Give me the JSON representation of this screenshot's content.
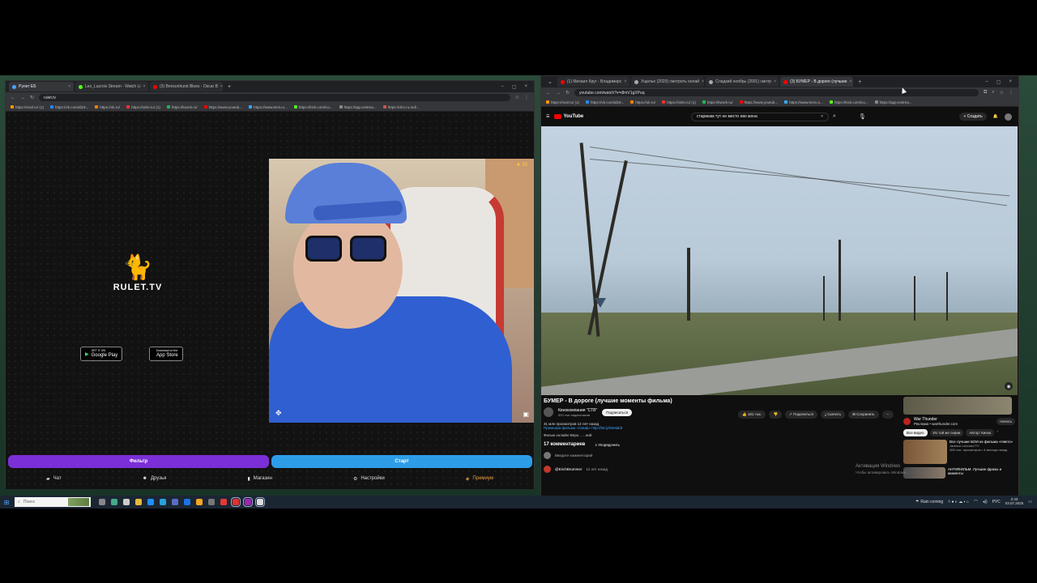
{
  "left_browser": {
    "tabs": [
      {
        "label": "Рулет ЕБ",
        "active": true,
        "color": "#4aa3ff"
      },
      {
        "label": "Leo_Lacroix Stream - Watch Li",
        "active": false,
        "color": "#53fc18"
      },
      {
        "label": "(3) Bensonhurst Blues - Oscar B",
        "active": false,
        "color": "#ff0000"
      }
    ],
    "url": "rulet.tv",
    "bookmarks": [
      "https://mail.ru/ (1)",
      "https://vk.com/id19...",
      "https://ok.ru/",
      "https://sinki.ru/ (1)",
      "https://kwork.ru/",
      "https://www.youtub...",
      "https://www.tenru.s...",
      "https://kick.com/ico...",
      "https://app.restrea...",
      "https://drm.ru.md/..."
    ]
  },
  "rulet": {
    "brand": "RULET.TV",
    "store_google": "Google Play",
    "store_google_sub": "GET IT ON",
    "store_apple": "App Store",
    "store_apple_sub": "Download on the",
    "webcam_badge": "★ 25",
    "btn_filter": "Фильтр",
    "btn_start": "Старт",
    "nav": {
      "chat": "Чат",
      "friends": "Друзья",
      "shop": "Магазин",
      "settings": "Настройки",
      "premium": "Премиум"
    }
  },
  "right_browser": {
    "tabs": [
      {
        "label": "(1) Михаил Круг - Владимирс",
        "color": "#ff0000"
      },
      {
        "label": "Ущелье (2025) смотреть онлай",
        "color": "#aaaaaa"
      },
      {
        "label": "Сладкий ноябрь (2001) смотр",
        "color": "#aaaaaa"
      },
      {
        "label": "(3) БУМЕР - В дороге (лучшие",
        "color": "#ff0000"
      }
    ],
    "url": "youtube.com/watch?v=dlmV1gXPuq",
    "bookmarks": [
      "https://mail.ru/ (1)",
      "https://vk.com/id19...",
      "https://ok.ru/",
      "https://sinki.ru/ (1)",
      "https://kwork.ru/",
      "https://www.youtub...",
      "https://www.tenru.s...",
      "https://kick.com/ico...",
      "https://app.restrea..."
    ]
  },
  "youtube": {
    "logo": "YouTube",
    "search_query": "старикам тут не место ево жена",
    "create": "+ Создать",
    "video_title": "БУМЕР - В дороге (лучшие моменты фильма)",
    "channel": "Кинокомпания \"СТВ\"",
    "subscribers": "520 тыс подписчиков",
    "subscribe": "Подписаться",
    "likes": "181 тыс.",
    "share": "Поделиться",
    "download": "Скачать",
    "save": "Сохранить",
    "views": "31 млн просмотров  12 лет назад",
    "desc_line": "Премьера фильма «Смиф» http://bit.ly/26ntaldt",
    "tags": "Фильм онлайн!  Верх... ...ний",
    "comments_count": "17 комментариев",
    "sort": "Упорядочить",
    "add_comment": "Введите комментарий",
    "first_comment_author": "@ErichBrummer",
    "first_comment_time": "12 лет назад",
    "ad_title": "War Thunder",
    "ad_sub": "Реклама • warthunder.com",
    "ad_begin": "Начать",
    "chips": [
      "Все видео",
      "Из той же серии",
      "Автор: Кинок"
    ],
    "rec1_title": "Все лучшие БОИ из фильма «Никто»",
    "rec1_meta": "Jackson Leonard TV",
    "rec1_views": "406 тыс. просмотров • 4 месяца назад",
    "rec2_title": "АНТИФИЛЬМ. Лучшие фразы и моменты",
    "watermark_title": "Активация Windows",
    "watermark_sub": "Чтобы активировать Windows..."
  },
  "taskbar": {
    "search": "Поиск",
    "weather": "Rain coming",
    "lang": "РУС",
    "time": "2:43",
    "date": "03.07.2025"
  }
}
